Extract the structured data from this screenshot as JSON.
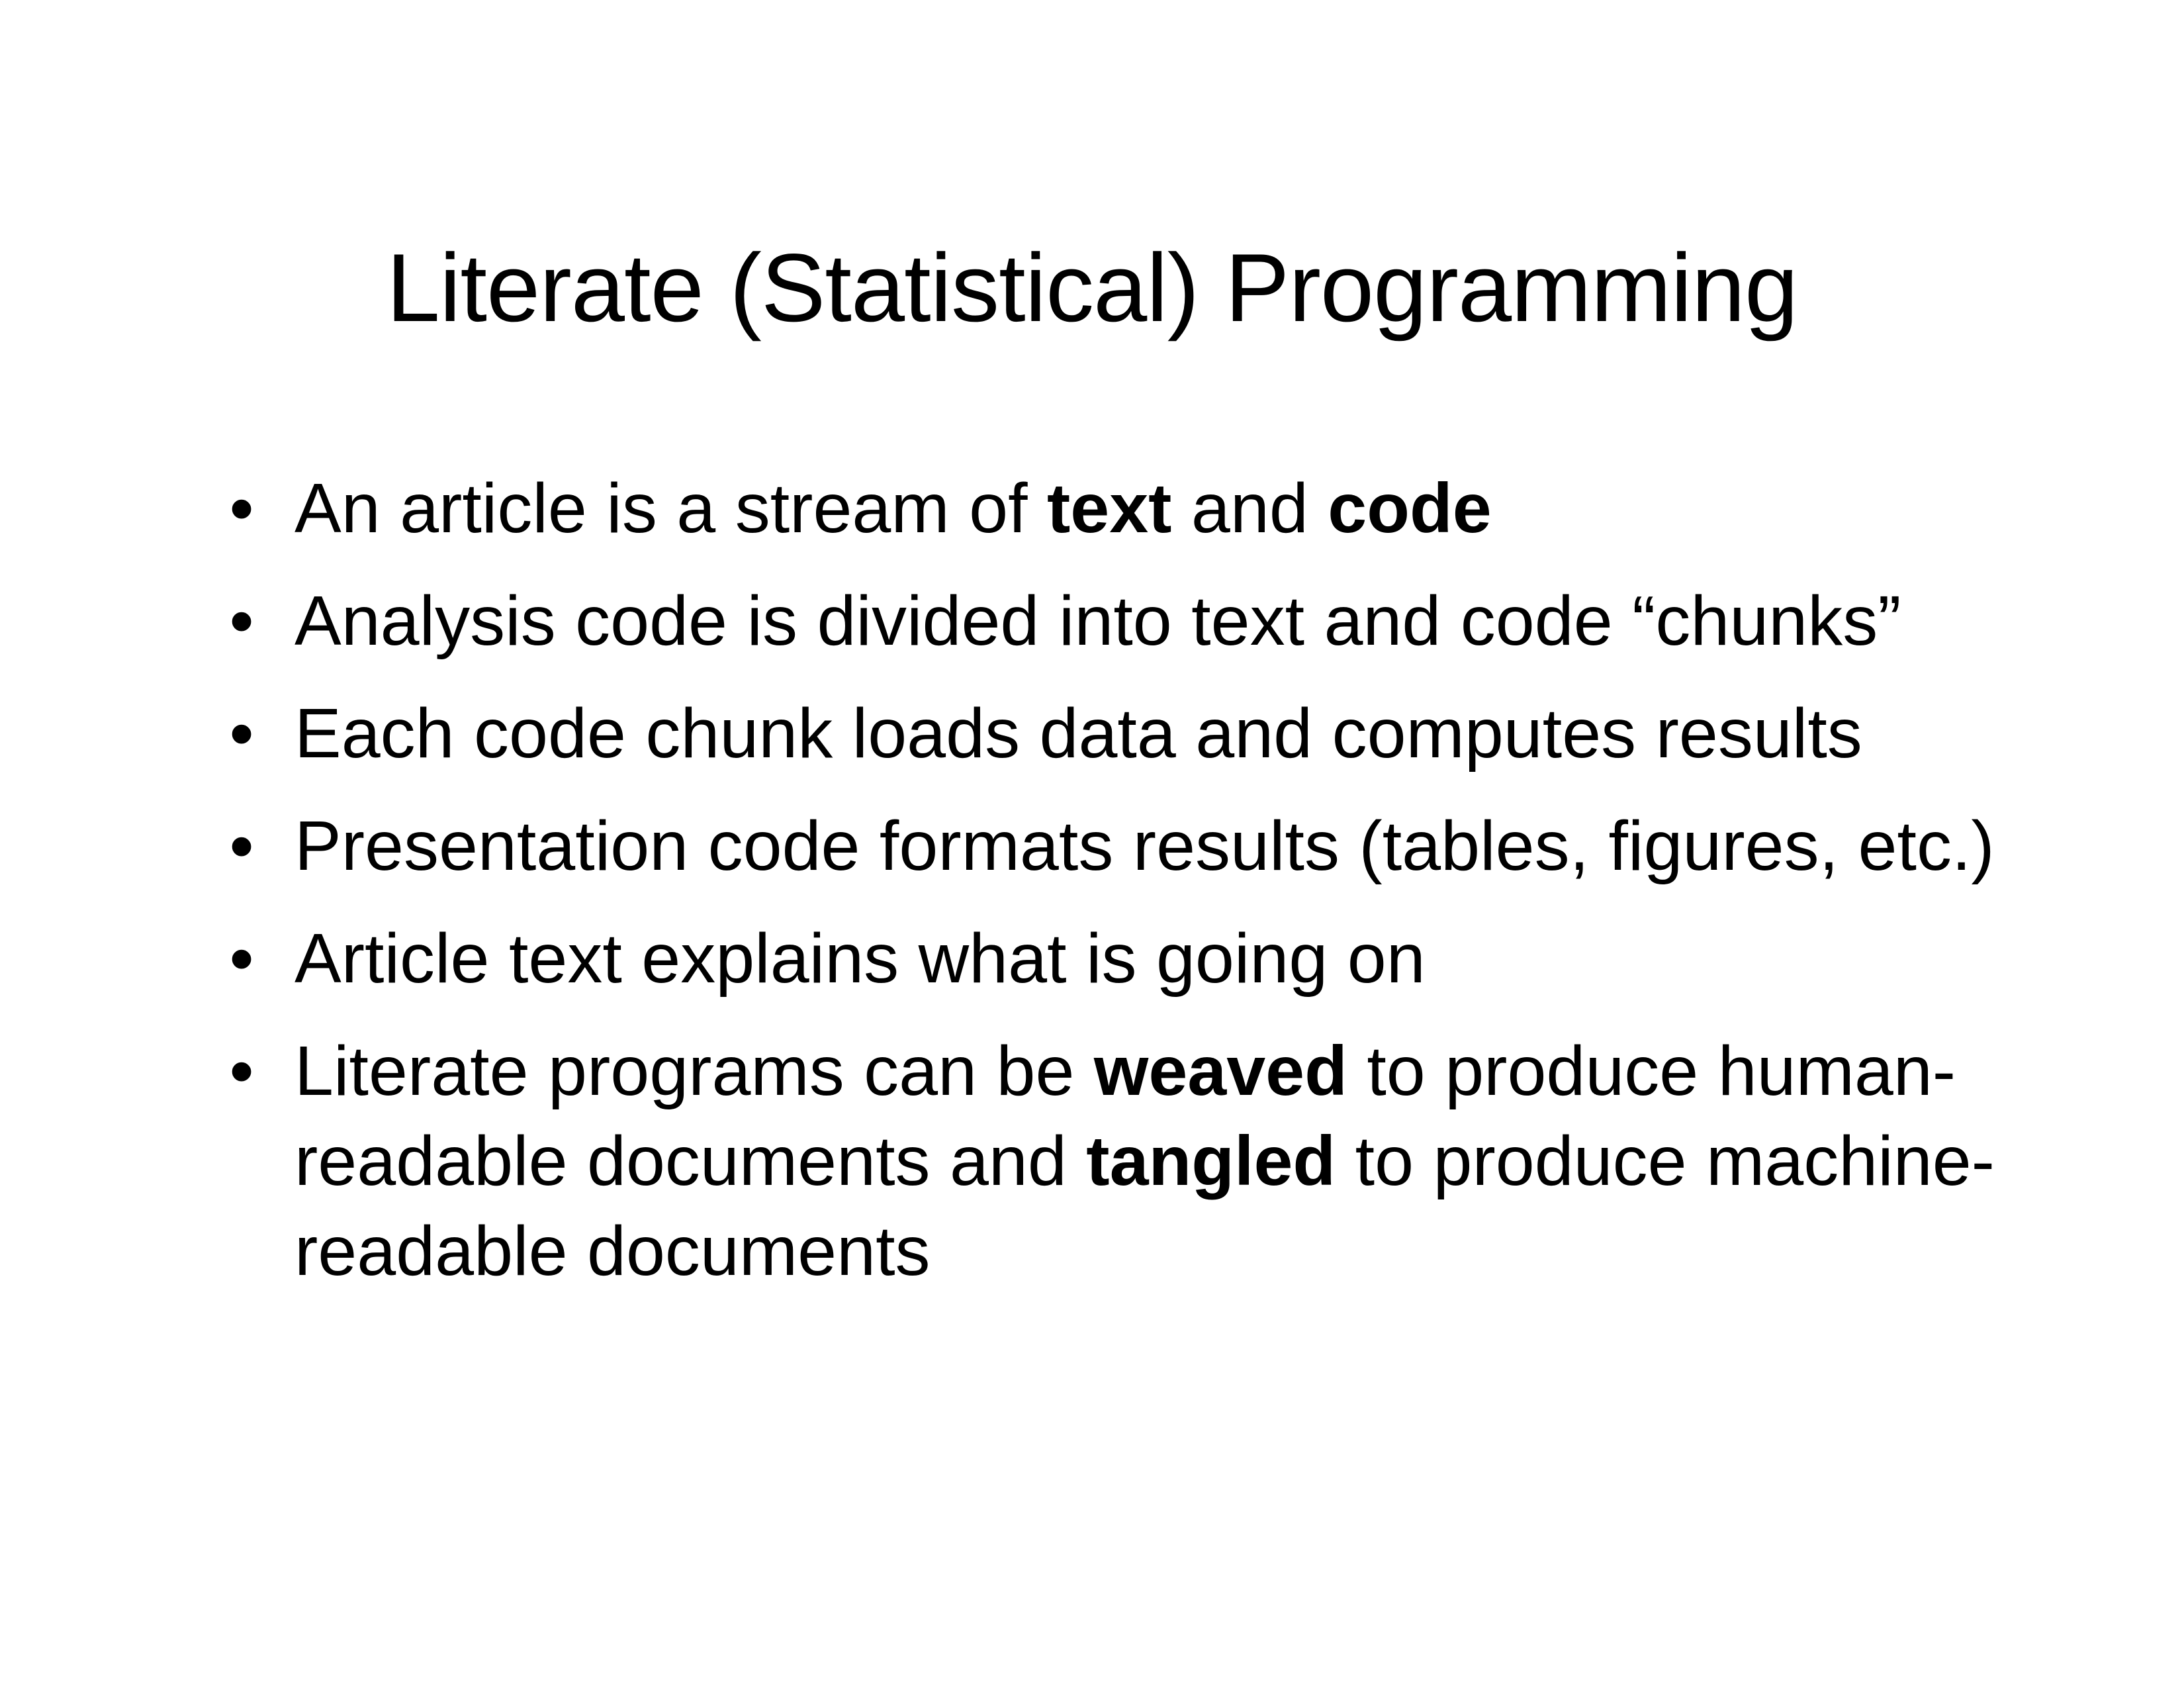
{
  "title": "Literate (Statistical) Programming",
  "bullet_marker": "•",
  "bullets": [
    {
      "parts": [
        {
          "text": "An article is a stream of ",
          "bold": false
        },
        {
          "text": "text",
          "bold": true
        },
        {
          "text": " and ",
          "bold": false
        },
        {
          "text": "code",
          "bold": true
        }
      ]
    },
    {
      "parts": [
        {
          "text": "Analysis code is divided into text and code “chunks”",
          "bold": false
        }
      ]
    },
    {
      "parts": [
        {
          "text": "Each code chunk loads data and computes results",
          "bold": false
        }
      ]
    },
    {
      "parts": [
        {
          "text": "Presentation code formats results (tables, figures, etc.)",
          "bold": false
        }
      ]
    },
    {
      "parts": [
        {
          "text": "Article text explains what is going on",
          "bold": false
        }
      ]
    },
    {
      "parts": [
        {
          "text": "Literate programs can be ",
          "bold": false
        },
        {
          "text": "weaved",
          "bold": true
        },
        {
          "text": " to produce human-readable documents and ",
          "bold": false
        },
        {
          "text": "tangled",
          "bold": true
        },
        {
          "text": " to produce machine-readable documents",
          "bold": false
        }
      ]
    }
  ]
}
